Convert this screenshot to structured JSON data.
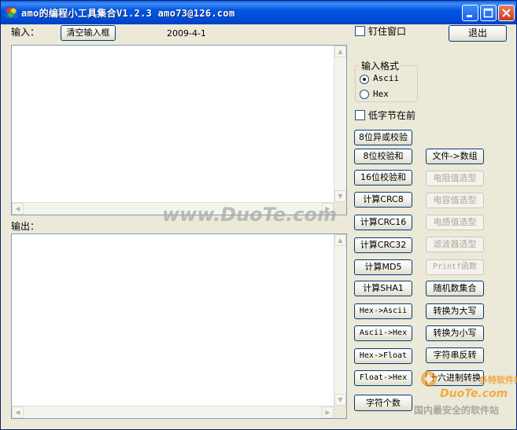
{
  "window": {
    "title": "amo的编程小工具集合V1.2.3 amo73@126.com",
    "controls": {
      "minimize": "–",
      "maximize": "□",
      "close": "✕"
    }
  },
  "input": {
    "label": "输入：",
    "clear_button": "清空输入框",
    "date": "2009-4-1",
    "value": ""
  },
  "output": {
    "label": "输出：",
    "value": ""
  },
  "options": {
    "pin_window": {
      "label": "钉住窗口",
      "checked": false
    },
    "exit_button": "退出",
    "input_format": {
      "title": "输入格式",
      "options": [
        "Ascii",
        "Hex"
      ],
      "selected": "Ascii"
    },
    "low_byte_first": {
      "label": "低字节在前",
      "checked": false
    }
  },
  "left_buttons": [
    {
      "label": "8位异或校验",
      "enabled": true
    },
    {
      "label": "8位校验和",
      "enabled": true
    },
    {
      "label": "16位校验和",
      "enabled": true
    },
    {
      "label": "计算CRC8",
      "enabled": true
    },
    {
      "label": "计算CRC16",
      "enabled": true
    },
    {
      "label": "计算CRC32",
      "enabled": true
    },
    {
      "label": "计算MD5",
      "enabled": true
    },
    {
      "label": "计算SHA1",
      "enabled": true
    },
    {
      "label": "Hex->Ascii",
      "enabled": true
    },
    {
      "label": "Ascii->Hex",
      "enabled": true
    },
    {
      "label": "Hex->Float",
      "enabled": true
    },
    {
      "label": "Float->Hex",
      "enabled": true
    },
    {
      "label": "字符个数",
      "enabled": true
    }
  ],
  "right_buttons": [
    {
      "label": "文件->数组",
      "enabled": true
    },
    {
      "label": "电阻值选型",
      "enabled": false
    },
    {
      "label": "电容值选型",
      "enabled": false
    },
    {
      "label": "电感值选型",
      "enabled": false
    },
    {
      "label": "滤波器选型",
      "enabled": false
    },
    {
      "label": "Printf函数",
      "enabled": false
    },
    {
      "label": "随机数集合",
      "enabled": true
    },
    {
      "label": "转换为大写",
      "enabled": true
    },
    {
      "label": "转换为小写",
      "enabled": true
    },
    {
      "label": "字符串反转",
      "enabled": true
    },
    {
      "label": "十六进制转换",
      "enabled": true
    }
  ],
  "watermarks": {
    "center": "www.DuoTe.com",
    "corner_brand": "DuoTe.com",
    "corner_tag": "多特软件站",
    "corner_slogan": "国内最安全的软件站"
  },
  "colors": {
    "titlebar": "#0054e3",
    "dialog_bg": "#ece9d8",
    "button_border": "#003c74",
    "disabled_text": "#aca899",
    "watermark_orange": "#f08a00"
  }
}
